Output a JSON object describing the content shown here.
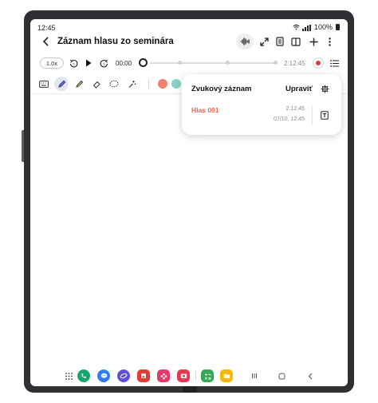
{
  "status": {
    "time": "12:45",
    "battery": "100%"
  },
  "header": {
    "title": "Záznam hlasu zo seminára"
  },
  "player": {
    "speed": "1.0x",
    "current_time": "00:00",
    "total_time": "2:12:45"
  },
  "colors": {
    "accent": "#e8634b",
    "swatch_salmon": "#f08070",
    "swatch_teal": "#86d2c6",
    "record_red": "#e53935"
  },
  "panel": {
    "title": "Zvukový záznam",
    "edit_label": "Upraviť",
    "recordings": [
      {
        "name": "Hlas 001",
        "duration": "2:12:45",
        "date": "07/10, 12:45"
      }
    ]
  },
  "icons": {
    "header": [
      "back-icon",
      "waveform-icon",
      "expand-icon",
      "page-view-icon",
      "book-view-icon",
      "add-icon",
      "more-icon"
    ],
    "toolbar": [
      "keyboard-icon",
      "pen-icon",
      "highlighter-icon",
      "eraser-icon",
      "lasso-icon",
      "magic-icon"
    ],
    "dock": [
      "apps-grid-icon",
      "phone-icon",
      "messages-icon",
      "internet-icon",
      "gallery-icon",
      "flower-icon",
      "camera-icon",
      "calculator-icon",
      "files-icon",
      "recents-icon",
      "home-icon",
      "back-nav-icon"
    ]
  }
}
